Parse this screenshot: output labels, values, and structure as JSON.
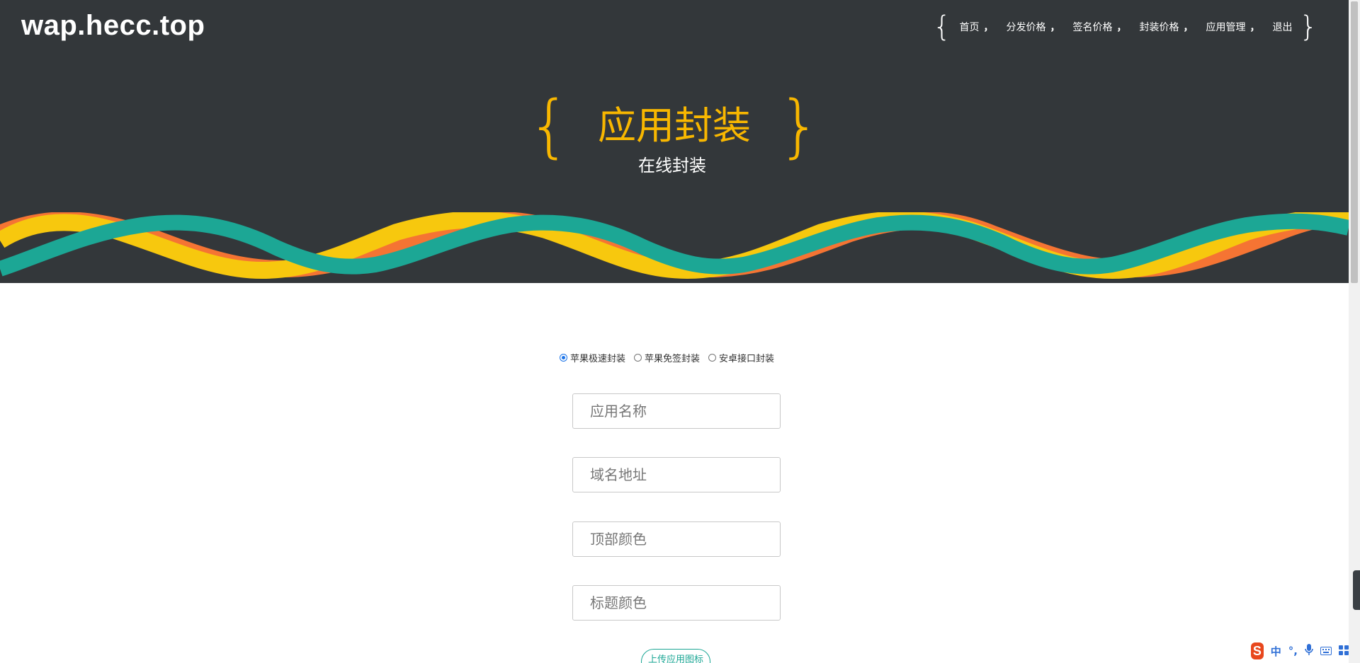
{
  "site": {
    "logo": "wap.hecc.top"
  },
  "nav": {
    "brace_open": "{",
    "brace_close": "}",
    "separator": "，",
    "items": [
      {
        "label": "首页"
      },
      {
        "label": "分发价格"
      },
      {
        "label": "签名价格"
      },
      {
        "label": "封装价格"
      },
      {
        "label": "应用管理"
      },
      {
        "label": "退出"
      }
    ]
  },
  "hero": {
    "brace_open": "{",
    "brace_close": "}",
    "title": "应用封装",
    "subtitle": "在线封装"
  },
  "form": {
    "radio_options": [
      {
        "label": "苹果极速封装",
        "checked": true
      },
      {
        "label": "苹果免签封装",
        "checked": false
      },
      {
        "label": "安卓接口封装",
        "checked": false
      }
    ],
    "app_name": {
      "placeholder": "应用名称",
      "value": ""
    },
    "domain": {
      "placeholder": "域名地址",
      "value": ""
    },
    "top_color": {
      "placeholder": "顶部颜色",
      "value": ""
    },
    "title_color": {
      "placeholder": "标题颜色",
      "value": ""
    },
    "upload_icon_label": "上传应用图标"
  },
  "ime": {
    "logo": "S",
    "mode": "中",
    "punct": "°,",
    "mic_icon": "microphone-icon",
    "keyboard_icon": "keyboard-icon",
    "grid_icon": "grid-icon"
  },
  "colors": {
    "header_bg": "#33373a",
    "accent_yellow": "#f8b700",
    "wave_teal": "#1ca795",
    "wave_yellow": "#f7c80e",
    "wave_orange": "#f57433"
  }
}
